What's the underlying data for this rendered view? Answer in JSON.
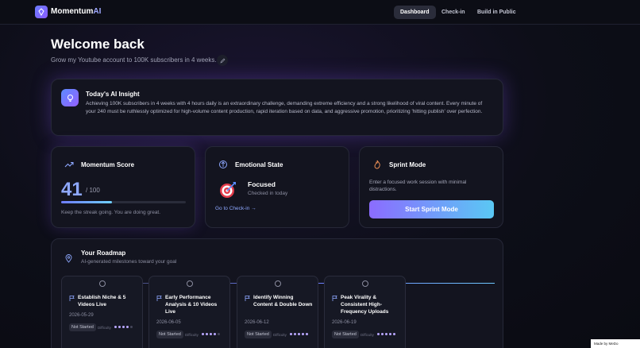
{
  "app": {
    "name_main": "Momentum",
    "name_accent": "AI"
  },
  "nav": [
    "Dashboard",
    "Check-in",
    "Build in Public"
  ],
  "header": {
    "title": "Welcome back",
    "goal": "Grow my Youtube account to 100K subscribers in 4 weeks."
  },
  "insight": {
    "title": "Today's AI Insight",
    "text": "Achieving 100K subscribers in 4 weeks with 4 hours daily is an extraordinary challenge, demanding extreme efficiency and a strong likelihood of viral content. Every minute of your 240 must be ruthlessly optimized for high-volume content production, rapid iteration based on data, and aggressive promotion, prioritizing 'hitting publish' over perfection."
  },
  "score": {
    "title": "Momentum Score",
    "value": "41",
    "max": "/ 100",
    "progress": 0.41,
    "note": "Keep the streak going. You are doing great."
  },
  "emotion": {
    "title": "Emotional State",
    "state": "Focused",
    "sub": "Checked in today",
    "link": "Go to Check-in"
  },
  "sprint": {
    "title": "Sprint Mode",
    "text": "Enter a focused work session with minimal distractions.",
    "button": "Start Sprint Mode"
  },
  "roadmap": {
    "title": "Your Roadmap",
    "subtitle": "AI-generated milestones toward your goal",
    "difficulty_label": "Difficulty",
    "milestones": [
      {
        "title": "Establish Niche & 5 Videos Live",
        "date": "2026-05-29",
        "status": "Not Started",
        "difficulty": 4
      },
      {
        "title": "Early Performance Analysis & 10 Videos Live",
        "date": "2026-06-05",
        "status": "Not Started",
        "difficulty": 4
      },
      {
        "title": "Identify Winning Content & Double Down",
        "date": "2026-06-12",
        "status": "Not Started",
        "difficulty": 5
      },
      {
        "title": "Peak Virality & Consistent High-Frequency Uploads",
        "date": "2026-06-19",
        "status": "Not Started",
        "difficulty": 5
      }
    ]
  },
  "badge": {
    "text": "Made by MeDo"
  }
}
